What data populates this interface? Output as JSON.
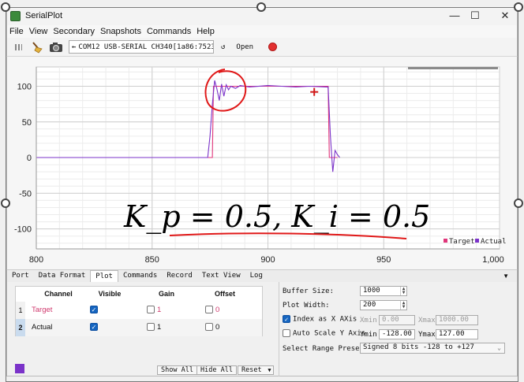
{
  "window": {
    "title": "SerialPlot",
    "minimize": "—",
    "maximize": "☐",
    "close": "✕"
  },
  "menu": [
    "File",
    "View",
    "Secondary",
    "Snapshots",
    "Commands",
    "Help"
  ],
  "toolbar": {
    "port": "COM12 USB-SERIAL CH340[1a86:7523]",
    "refresh": "↺",
    "open_label": "Open"
  },
  "chart_data": {
    "type": "line",
    "xlim": [
      800,
      1000
    ],
    "ylim": [
      -128,
      127
    ],
    "x_ticks": [
      "800",
      "850",
      "900",
      "950",
      "1,000"
    ],
    "y_ticks": [
      "100",
      "50",
      "0",
      "-50",
      "-100"
    ],
    "grid": true,
    "legend": "bottom-right",
    "series": [
      {
        "name": "Target",
        "color": "#e0357a",
        "points": [
          [
            800,
            0
          ],
          [
            876,
            0
          ],
          [
            876.5,
            100
          ],
          [
            926,
            100
          ],
          [
            926.5,
            0
          ],
          [
            930,
            0
          ]
        ]
      },
      {
        "name": "Actual",
        "color": "#7b33c9",
        "points": [
          [
            800,
            0
          ],
          [
            874,
            0
          ],
          [
            875,
            30
          ],
          [
            876,
            75
          ],
          [
            877,
            108
          ],
          [
            878,
            96
          ],
          [
            879,
            80
          ],
          [
            880,
            103
          ],
          [
            881,
            86
          ],
          [
            882,
            102
          ],
          [
            883,
            95
          ],
          [
            884,
            100
          ],
          [
            886,
            97
          ],
          [
            888,
            101
          ],
          [
            892,
            99
          ],
          [
            900,
            101
          ],
          [
            906,
            100
          ],
          [
            912,
            99
          ],
          [
            918,
            100
          ],
          [
            925,
            99
          ],
          [
            926,
            99
          ],
          [
            927,
            30
          ],
          [
            928,
            -20
          ],
          [
            929,
            10
          ],
          [
            930,
            4
          ],
          [
            931,
            0
          ]
        ]
      }
    ],
    "cursor_marker": {
      "x": 920,
      "y": 92
    }
  },
  "annotation": {
    "formula": "K_p = 0.5, K_i = 0.5"
  },
  "tabs": [
    "Port",
    "Data Format",
    "Plot",
    "Commands",
    "Record",
    "Text View",
    "Log"
  ],
  "active_tab": "Plot",
  "channels": {
    "headers": [
      "Channel",
      "Visible",
      "Gain",
      "Offset"
    ],
    "rows": [
      {
        "num": "1",
        "name": "Target",
        "gain": "1",
        "offset": "0",
        "color": "#d03a6e"
      },
      {
        "num": "2",
        "name": "Actual",
        "gain": "1",
        "offset": "0",
        "color": "#222222"
      }
    ]
  },
  "buttons": {
    "show_all": "Show All",
    "hide_all": "Hide All",
    "reset": "Reset"
  },
  "settings": {
    "buffer_size_label": "Buffer Size:",
    "buffer_size": "1000",
    "plot_width_label": "Plot Width:",
    "plot_width": "200",
    "index_as_x_label": "Index as X AXis",
    "xmin_label": "Xmin",
    "xmin": "0.00",
    "xmax_label": "Xmax",
    "xmax": "1000.00",
    "auto_scale_label": "Auto Scale Y Axis",
    "ymin_label": "Ymin",
    "ymin": "-128.00",
    "ymax_label": "Ymax",
    "ymax": "127.00",
    "range_preset_label": "Select Range Preset:",
    "range_preset": "Signed 8 bits -128 to +127"
  }
}
